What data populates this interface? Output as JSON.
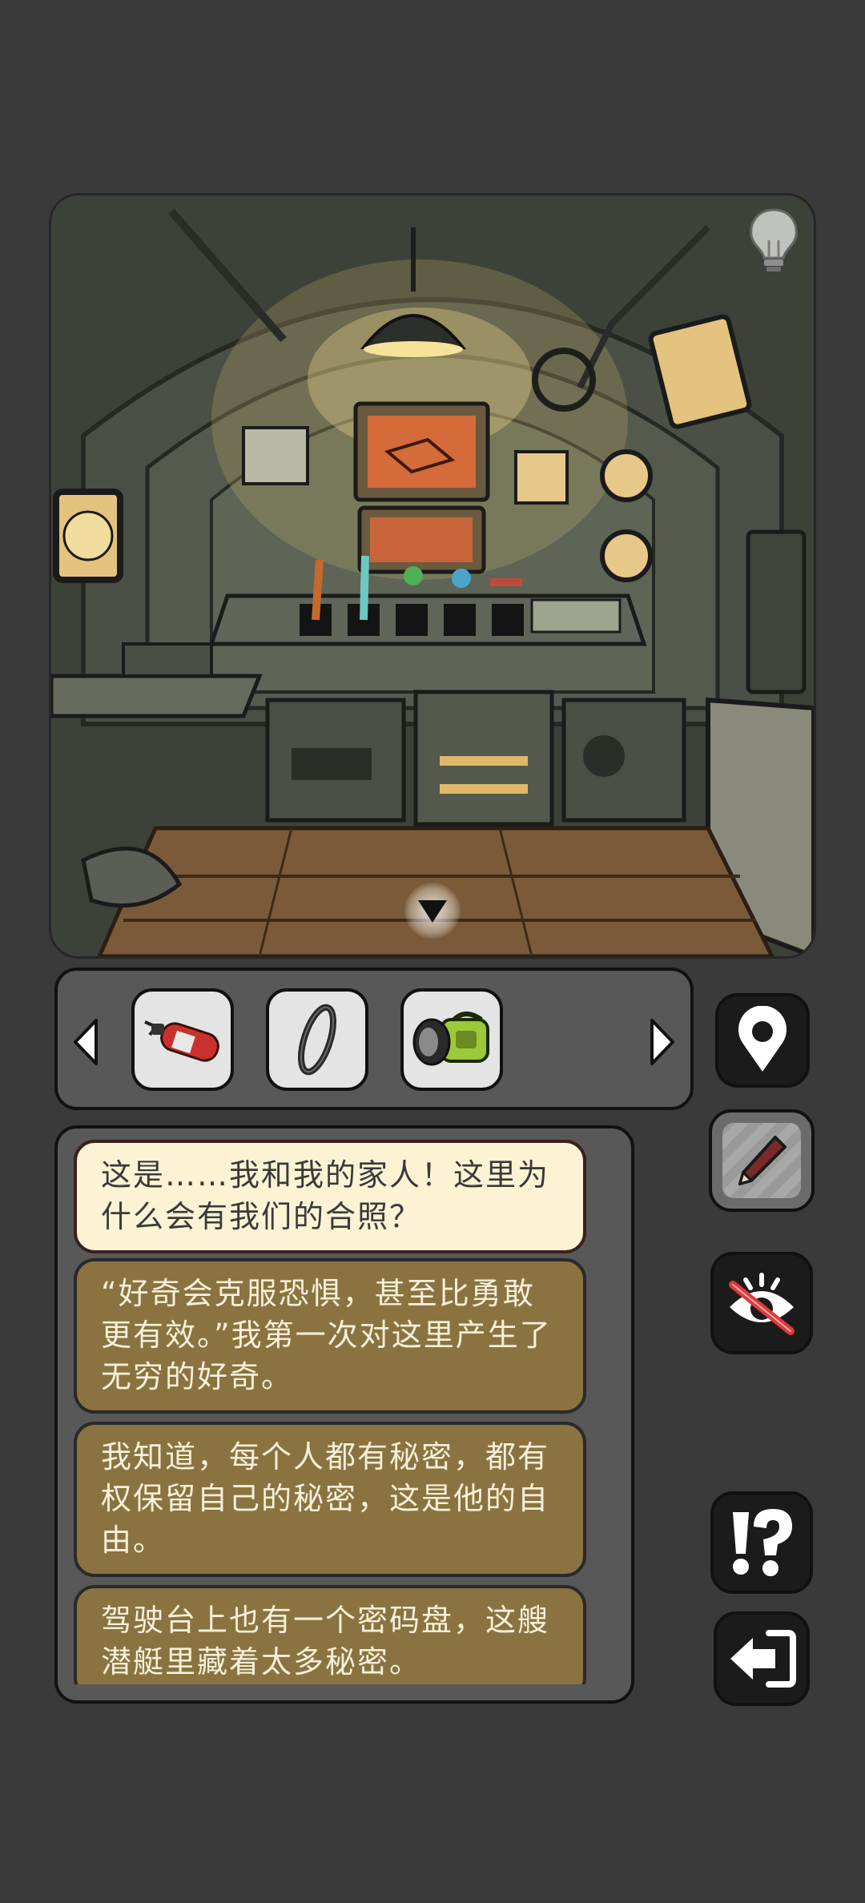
{
  "inventory": {
    "items": [
      {
        "name": "fire-extinguisher"
      },
      {
        "name": "rubber-ring"
      },
      {
        "name": "flashlight"
      }
    ]
  },
  "dialogue": {
    "messages": [
      {
        "text": "这是……我和我的家人！这里为什么会有我们的合照？",
        "state": "current"
      },
      {
        "text": "“好奇会克服恐惧，甚至比勇敢更有效。”我第一次对这里产生了无穷的好奇。",
        "state": "past"
      },
      {
        "text": "我知道，每个人都有秘密，都有权保留自己的秘密，这是他的自由。",
        "state": "past"
      },
      {
        "text": "驾驶台上也有一个密码盘，这艘潜艇里藏着太多秘密。",
        "state": "past"
      }
    ]
  },
  "colors": {
    "background": "#3a3a3a",
    "panel": "#585858",
    "bubble_current": "#fbf3d3",
    "bubble_past": "#8a7340"
  },
  "icons": {
    "hint": "lightbulb-icon",
    "nav": "triangle-down-icon",
    "map": "map-pin-icon",
    "notes": "pencil-icon",
    "hide": "eye-crossed-icon",
    "help": "exclamation-question-icon",
    "exit": "exit-arrow-icon"
  }
}
